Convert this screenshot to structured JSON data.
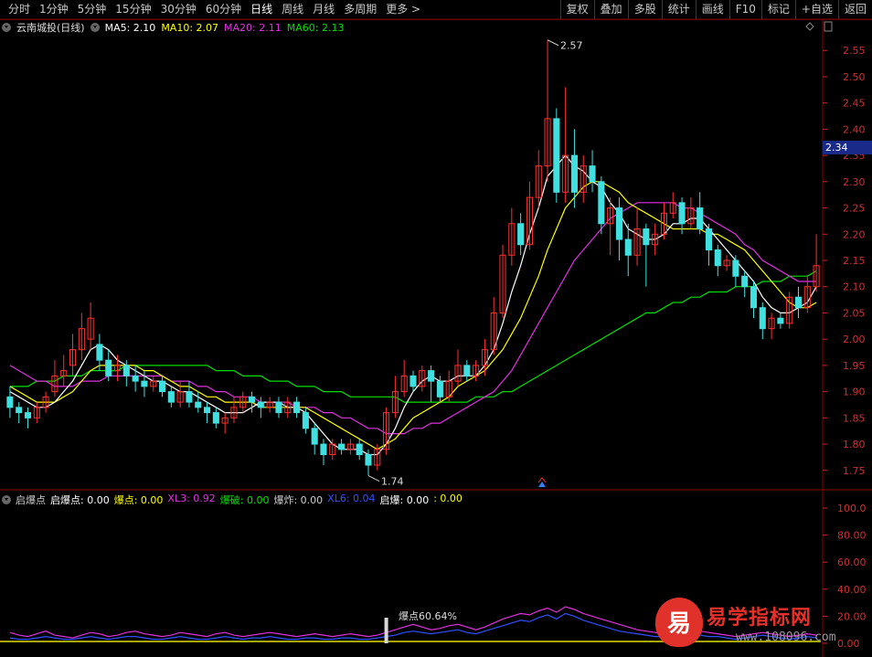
{
  "toolbar": {
    "periods": [
      "分时",
      "1分钟",
      "5分钟",
      "15分钟",
      "30分钟",
      "60分钟",
      "日线",
      "周线",
      "月线",
      "多周期",
      "更多 >"
    ],
    "active_period": "日线",
    "buttons": [
      "复权",
      "叠加",
      "多股",
      "统计",
      "画线",
      "F10",
      "标记",
      "+自选",
      "返回"
    ]
  },
  "main": {
    "stock_name": "云南城投(日线)",
    "ma": [
      {
        "label": "MA5: 2.10",
        "color": "#ffffff"
      },
      {
        "label": "MA10: 2.07",
        "color": "#ffff00"
      },
      {
        "label": "MA20: 2.11",
        "color": "#e030e0"
      },
      {
        "label": "MA60: 2.13",
        "color": "#00e000"
      }
    ],
    "current_price": "2.34",
    "high_label": "2.57",
    "low_label": "1.74",
    "y_ticks": [
      "2.55",
      "2.50",
      "2.45",
      "2.40",
      "2.35",
      "2.30",
      "2.25",
      "2.20",
      "2.15",
      "2.10",
      "2.05",
      "2.00",
      "1.95",
      "1.90",
      "1.85",
      "1.80",
      "1.75"
    ],
    "up_color": "#ff3030",
    "down_color": "#40e0e0"
  },
  "indicator": {
    "items": [
      {
        "label": "启爆点",
        "color": "#cccccc"
      },
      {
        "label": "启爆点: 0.00",
        "color": "#ffffff"
      },
      {
        "label": "爆点: 0.00",
        "color": "#ffff00"
      },
      {
        "label": "XL3: 0.92",
        "color": "#e030e0"
      },
      {
        "label": "爆破: 0.00",
        "color": "#00e000"
      },
      {
        "label": "爆炸: 0.00",
        "color": "#cccccc"
      },
      {
        "label": "XL6: 0.04",
        "color": "#3050ff"
      },
      {
        "label": "启爆: 0.00",
        "color": "#ffffff"
      },
      {
        "label": ": 0.00",
        "color": "#ffff00"
      }
    ],
    "y_ticks": [
      "100.0",
      "80.00",
      "60.00",
      "40.00",
      "20.00",
      "0.00"
    ],
    "explosion_label": "爆点60.64%"
  },
  "watermark": {
    "logo_char": "易",
    "text": "易学指标网",
    "url": "www.108096.com"
  },
  "chart_data": {
    "type": "candlestick",
    "ylim": [
      1.72,
      2.58
    ],
    "candles": [
      [
        1.89,
        1.87,
        1.91,
        1.85
      ],
      [
        1.87,
        1.86,
        1.88,
        1.84
      ],
      [
        1.86,
        1.85,
        1.87,
        1.83
      ],
      [
        1.85,
        1.87,
        1.88,
        1.84
      ],
      [
        1.87,
        1.89,
        1.9,
        1.86
      ],
      [
        1.9,
        1.93,
        1.96,
        1.89
      ],
      [
        1.93,
        1.94,
        1.97,
        1.91
      ],
      [
        1.95,
        1.98,
        2.01,
        1.93
      ],
      [
        1.98,
        2.02,
        2.05,
        1.96
      ],
      [
        2.0,
        2.04,
        2.07,
        1.98
      ],
      [
        1.99,
        1.96,
        2.01,
        1.94
      ],
      [
        1.96,
        1.93,
        1.98,
        1.92
      ],
      [
        1.94,
        1.95,
        1.97,
        1.92
      ],
      [
        1.95,
        1.93,
        1.96,
        1.91
      ],
      [
        1.93,
        1.92,
        1.95,
        1.9
      ],
      [
        1.92,
        1.91,
        1.94,
        1.89
      ],
      [
        1.91,
        1.92,
        1.93,
        1.9
      ],
      [
        1.92,
        1.9,
        1.93,
        1.89
      ],
      [
        1.9,
        1.88,
        1.91,
        1.87
      ],
      [
        1.88,
        1.9,
        1.92,
        1.87
      ],
      [
        1.9,
        1.88,
        1.92,
        1.87
      ],
      [
        1.88,
        1.87,
        1.9,
        1.86
      ],
      [
        1.87,
        1.86,
        1.88,
        1.84
      ],
      [
        1.86,
        1.84,
        1.87,
        1.83
      ],
      [
        1.84,
        1.85,
        1.86,
        1.82
      ],
      [
        1.85,
        1.87,
        1.89,
        1.84
      ],
      [
        1.87,
        1.89,
        1.9,
        1.86
      ],
      [
        1.89,
        1.88,
        1.9,
        1.86
      ],
      [
        1.88,
        1.87,
        1.89,
        1.85
      ],
      [
        1.87,
        1.88,
        1.89,
        1.86
      ],
      [
        1.88,
        1.86,
        1.89,
        1.85
      ],
      [
        1.86,
        1.88,
        1.89,
        1.85
      ],
      [
        1.88,
        1.86,
        1.89,
        1.85
      ],
      [
        1.86,
        1.83,
        1.87,
        1.82
      ],
      [
        1.83,
        1.8,
        1.84,
        1.78
      ],
      [
        1.8,
        1.78,
        1.81,
        1.76
      ],
      [
        1.78,
        1.8,
        1.81,
        1.77
      ],
      [
        1.8,
        1.79,
        1.81,
        1.78
      ],
      [
        1.79,
        1.8,
        1.81,
        1.78
      ],
      [
        1.8,
        1.78,
        1.81,
        1.77
      ],
      [
        1.78,
        1.76,
        1.79,
        1.74
      ],
      [
        1.76,
        1.79,
        1.8,
        1.75
      ],
      [
        1.79,
        1.86,
        1.87,
        1.78
      ],
      [
        1.86,
        1.9,
        1.93,
        1.85
      ],
      [
        1.9,
        1.93,
        1.96,
        1.89
      ],
      [
        1.93,
        1.91,
        1.94,
        1.9
      ],
      [
        1.91,
        1.94,
        1.95,
        1.9
      ],
      [
        1.94,
        1.92,
        1.95,
        1.88
      ],
      [
        1.92,
        1.89,
        1.93,
        1.88
      ],
      [
        1.89,
        1.92,
        1.94,
        1.88
      ],
      [
        1.92,
        1.95,
        1.98,
        1.91
      ],
      [
        1.95,
        1.93,
        1.96,
        1.92
      ],
      [
        1.93,
        1.95,
        1.96,
        1.92
      ],
      [
        1.95,
        1.98,
        2.0,
        1.93
      ],
      [
        1.98,
        2.05,
        2.08,
        1.97
      ],
      [
        2.05,
        2.16,
        2.18,
        2.04
      ],
      [
        2.16,
        2.22,
        2.25,
        2.14
      ],
      [
        2.22,
        2.18,
        2.24,
        2.16
      ],
      [
        2.18,
        2.27,
        2.3,
        2.17
      ],
      [
        2.27,
        2.33,
        2.36,
        2.25
      ],
      [
        2.33,
        2.42,
        2.57,
        2.3
      ],
      [
        2.42,
        2.28,
        2.44,
        2.26
      ],
      [
        2.28,
        2.35,
        2.48,
        2.26
      ],
      [
        2.35,
        2.28,
        2.4,
        2.25
      ],
      [
        2.28,
        2.33,
        2.35,
        2.26
      ],
      [
        2.33,
        2.3,
        2.36,
        2.28
      ],
      [
        2.3,
        2.22,
        2.31,
        2.2
      ],
      [
        2.22,
        2.25,
        2.27,
        2.16
      ],
      [
        2.25,
        2.19,
        2.27,
        2.15
      ],
      [
        2.19,
        2.16,
        2.22,
        2.12
      ],
      [
        2.16,
        2.21,
        2.25,
        2.14
      ],
      [
        2.21,
        2.18,
        2.22,
        2.1
      ],
      [
        2.18,
        2.2,
        2.22,
        2.16
      ],
      [
        2.2,
        2.24,
        2.26,
        2.19
      ],
      [
        2.24,
        2.26,
        2.28,
        2.23
      ],
      [
        2.26,
        2.22,
        2.27,
        2.2
      ],
      [
        2.22,
        2.25,
        2.27,
        2.21
      ],
      [
        2.25,
        2.21,
        2.28,
        2.2
      ],
      [
        2.21,
        2.17,
        2.22,
        2.14
      ],
      [
        2.17,
        2.14,
        2.18,
        2.12
      ],
      [
        2.14,
        2.15,
        2.16,
        2.13
      ],
      [
        2.15,
        2.12,
        2.16,
        2.1
      ],
      [
        2.12,
        2.1,
        2.13,
        2.08
      ],
      [
        2.1,
        2.06,
        2.11,
        2.04
      ],
      [
        2.06,
        2.02,
        2.07,
        2.0
      ],
      [
        2.02,
        2.04,
        2.05,
        2.0
      ],
      [
        2.04,
        2.03,
        2.05,
        2.02
      ],
      [
        2.03,
        2.08,
        2.09,
        2.02
      ],
      [
        2.08,
        2.06,
        2.1,
        2.04
      ],
      [
        2.06,
        2.1,
        2.12,
        2.05
      ],
      [
        2.1,
        2.14,
        2.2,
        2.09
      ]
    ],
    "ma5": [
      1.9,
      1.89,
      1.88,
      1.87,
      1.87,
      1.88,
      1.9,
      1.92,
      1.95,
      1.98,
      1.99,
      1.98,
      1.96,
      1.95,
      1.94,
      1.93,
      1.92,
      1.92,
      1.91,
      1.9,
      1.9,
      1.89,
      1.88,
      1.87,
      1.86,
      1.86,
      1.86,
      1.87,
      1.88,
      1.88,
      1.88,
      1.87,
      1.87,
      1.86,
      1.84,
      1.82,
      1.8,
      1.79,
      1.79,
      1.79,
      1.78,
      1.78,
      1.8,
      1.83,
      1.87,
      1.9,
      1.92,
      1.93,
      1.92,
      1.92,
      1.93,
      1.93,
      1.93,
      1.95,
      1.98,
      2.03,
      2.09,
      2.14,
      2.2,
      2.25,
      2.31,
      2.33,
      2.35,
      2.33,
      2.32,
      2.3,
      2.29,
      2.26,
      2.24,
      2.21,
      2.2,
      2.19,
      2.19,
      2.2,
      2.22,
      2.22,
      2.23,
      2.23,
      2.21,
      2.19,
      2.17,
      2.15,
      2.13,
      2.11,
      2.08,
      2.06,
      2.05,
      2.05,
      2.06,
      2.07,
      2.1
    ],
    "ma10": [
      1.91,
      1.9,
      1.89,
      1.88,
      1.88,
      1.88,
      1.89,
      1.9,
      1.92,
      1.94,
      1.95,
      1.95,
      1.95,
      1.95,
      1.95,
      1.94,
      1.94,
      1.93,
      1.92,
      1.91,
      1.91,
      1.9,
      1.89,
      1.89,
      1.88,
      1.88,
      1.88,
      1.88,
      1.87,
      1.87,
      1.87,
      1.87,
      1.87,
      1.87,
      1.86,
      1.85,
      1.84,
      1.83,
      1.82,
      1.81,
      1.8,
      1.79,
      1.8,
      1.81,
      1.83,
      1.85,
      1.86,
      1.87,
      1.88,
      1.89,
      1.91,
      1.92,
      1.93,
      1.94,
      1.96,
      1.98,
      2.01,
      2.04,
      2.08,
      2.12,
      2.17,
      2.21,
      2.25,
      2.27,
      2.29,
      2.3,
      2.3,
      2.29,
      2.28,
      2.26,
      2.25,
      2.24,
      2.23,
      2.22,
      2.21,
      2.21,
      2.21,
      2.21,
      2.2,
      2.2,
      2.19,
      2.18,
      2.17,
      2.15,
      2.13,
      2.11,
      2.09,
      2.07,
      2.06,
      2.06,
      2.07
    ],
    "ma20": [
      1.95,
      1.94,
      1.93,
      1.92,
      1.92,
      1.91,
      1.91,
      1.91,
      1.92,
      1.92,
      1.92,
      1.93,
      1.93,
      1.93,
      1.93,
      1.93,
      1.93,
      1.93,
      1.92,
      1.92,
      1.92,
      1.91,
      1.91,
      1.9,
      1.9,
      1.89,
      1.89,
      1.89,
      1.88,
      1.88,
      1.88,
      1.88,
      1.87,
      1.87,
      1.87,
      1.86,
      1.86,
      1.85,
      1.85,
      1.84,
      1.83,
      1.83,
      1.82,
      1.82,
      1.82,
      1.83,
      1.83,
      1.84,
      1.84,
      1.85,
      1.86,
      1.87,
      1.88,
      1.89,
      1.9,
      1.92,
      1.94,
      1.97,
      2.0,
      2.03,
      2.06,
      2.09,
      2.12,
      2.15,
      2.17,
      2.19,
      2.21,
      2.23,
      2.24,
      2.25,
      2.26,
      2.26,
      2.26,
      2.26,
      2.26,
      2.25,
      2.25,
      2.24,
      2.23,
      2.22,
      2.21,
      2.2,
      2.18,
      2.17,
      2.15,
      2.14,
      2.13,
      2.12,
      2.11,
      2.11,
      2.11
    ],
    "ma60": [
      1.91,
      1.91,
      1.91,
      1.92,
      1.92,
      1.92,
      1.93,
      1.93,
      1.93,
      1.94,
      1.94,
      1.94,
      1.94,
      1.95,
      1.95,
      1.95,
      1.95,
      1.95,
      1.95,
      1.95,
      1.95,
      1.95,
      1.95,
      1.94,
      1.94,
      1.94,
      1.93,
      1.93,
      1.93,
      1.92,
      1.92,
      1.92,
      1.91,
      1.91,
      1.91,
      1.9,
      1.9,
      1.9,
      1.89,
      1.89,
      1.89,
      1.89,
      1.89,
      1.89,
      1.88,
      1.88,
      1.88,
      1.88,
      1.88,
      1.88,
      1.88,
      1.88,
      1.89,
      1.89,
      1.89,
      1.9,
      1.9,
      1.91,
      1.92,
      1.93,
      1.94,
      1.95,
      1.96,
      1.97,
      1.98,
      1.99,
      2.0,
      2.01,
      2.02,
      2.03,
      2.04,
      2.05,
      2.05,
      2.06,
      2.07,
      2.07,
      2.08,
      2.08,
      2.09,
      2.09,
      2.09,
      2.1,
      2.1,
      2.1,
      2.11,
      2.11,
      2.11,
      2.12,
      2.12,
      2.12,
      2.13
    ],
    "ind_ylim": [
      0,
      100
    ],
    "xl3": [
      8,
      6,
      5,
      7,
      9,
      6,
      5,
      4,
      6,
      8,
      7,
      5,
      6,
      8,
      9,
      7,
      6,
      5,
      6,
      8,
      7,
      6,
      5,
      7,
      8,
      6,
      5,
      6,
      7,
      8,
      7,
      6,
      5,
      6,
      7,
      6,
      5,
      6,
      7,
      6,
      5,
      6,
      8,
      10,
      12,
      14,
      12,
      10,
      11,
      13,
      14,
      12,
      10,
      12,
      15,
      18,
      20,
      22,
      21,
      24,
      26,
      23,
      27,
      25,
      22,
      20,
      18,
      16,
      14,
      12,
      10,
      9,
      8,
      7,
      6,
      7,
      8,
      9,
      8,
      7,
      6,
      5,
      6,
      7,
      8,
      7,
      6,
      5,
      6,
      7,
      6
    ],
    "xl6": [
      4,
      3,
      3,
      4,
      5,
      4,
      3,
      3,
      4,
      5,
      4,
      3,
      4,
      5,
      5,
      4,
      3,
      3,
      4,
      5,
      4,
      3,
      3,
      4,
      5,
      4,
      3,
      4,
      4,
      5,
      4,
      3,
      3,
      4,
      4,
      3,
      3,
      4,
      4,
      3,
      3,
      4,
      5,
      6,
      8,
      9,
      8,
      7,
      8,
      9,
      10,
      8,
      7,
      9,
      11,
      13,
      15,
      17,
      16,
      19,
      21,
      18,
      22,
      20,
      17,
      15,
      13,
      11,
      9,
      8,
      7,
      6,
      5,
      5,
      4,
      5,
      6,
      6,
      5,
      5,
      4,
      3,
      4,
      5,
      6,
      5,
      4,
      3,
      4,
      5,
      4
    ],
    "explosion_bar_index": 42,
    "explosion_value": 60.64
  }
}
